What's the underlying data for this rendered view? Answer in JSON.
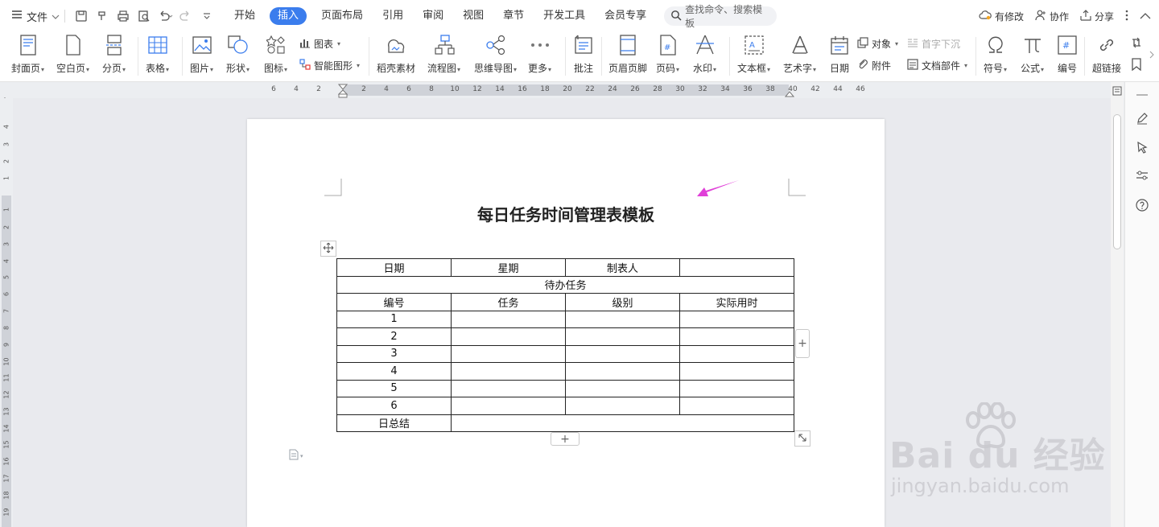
{
  "menubar": {
    "file_label": "文件",
    "tabs": [
      "开始",
      "插入",
      "页面布局",
      "引用",
      "审阅",
      "视图",
      "章节",
      "开发工具",
      "会员专享"
    ],
    "active_tab": "插入",
    "search_placeholder": "查找命令、搜索模板",
    "right": {
      "modified": "有修改",
      "collaborate": "协作",
      "share": "分享"
    }
  },
  "ribbon": {
    "cover": "封面页",
    "blank": "空白页",
    "page_break": "分页",
    "table": "表格",
    "picture": "图片",
    "shape": "形状",
    "icon": "图标",
    "chart": "图表",
    "smart_shape": "智能图形",
    "docer": "稻壳素材",
    "flowchart": "流程图",
    "mindmap": "思维导图",
    "more": "更多",
    "comment": "批注",
    "header_footer": "页眉页脚",
    "page_number": "页码",
    "watermark": "水印",
    "textbox": "文本框",
    "wordart": "艺术字",
    "date": "日期",
    "object": "对象",
    "attachment": "附件",
    "drop_cap": "首字下沉",
    "doc_parts": "文档部件",
    "symbol": "符号",
    "formula": "公式",
    "numbering": "编号",
    "hyperlink": "超链接"
  },
  "hruler_ticks": [
    "6",
    "4",
    "2",
    "2",
    "4",
    "6",
    "8",
    "10",
    "12",
    "14",
    "16",
    "18",
    "20",
    "22",
    "24",
    "26",
    "28",
    "30",
    "32",
    "34",
    "36",
    "38",
    "40",
    "42",
    "44",
    "46"
  ],
  "vruler_ticks": [
    "4",
    "3",
    "2",
    "1",
    "1",
    "2",
    "3",
    "4",
    "5",
    "6",
    "7",
    "8",
    "9",
    "10",
    "11",
    "12",
    "13",
    "14",
    "15",
    "16",
    "17",
    "18",
    "19"
  ],
  "document": {
    "title": "每日任务时间管理表模板",
    "table": {
      "row1": [
        "日期",
        "星期",
        "制表人",
        ""
      ],
      "section": "待办任务",
      "header": [
        "编号",
        "任务",
        "级别",
        "实际用时"
      ],
      "rows": [
        [
          "1",
          "",
          "",
          ""
        ],
        [
          "2",
          "",
          "",
          ""
        ],
        [
          "3",
          "",
          "",
          ""
        ],
        [
          "4",
          "",
          "",
          ""
        ],
        [
          "5",
          "",
          "",
          ""
        ],
        [
          "6",
          "",
          "",
          ""
        ]
      ],
      "summary_label": "日总结"
    }
  },
  "watermark": {
    "line1": "Bai du 经验",
    "line2": "jingyan.baidu.com"
  },
  "colors": {
    "accent": "#3b7ded",
    "arrow": "#e040d8",
    "page": "#ffffff",
    "workspace": "#e9eaee"
  }
}
